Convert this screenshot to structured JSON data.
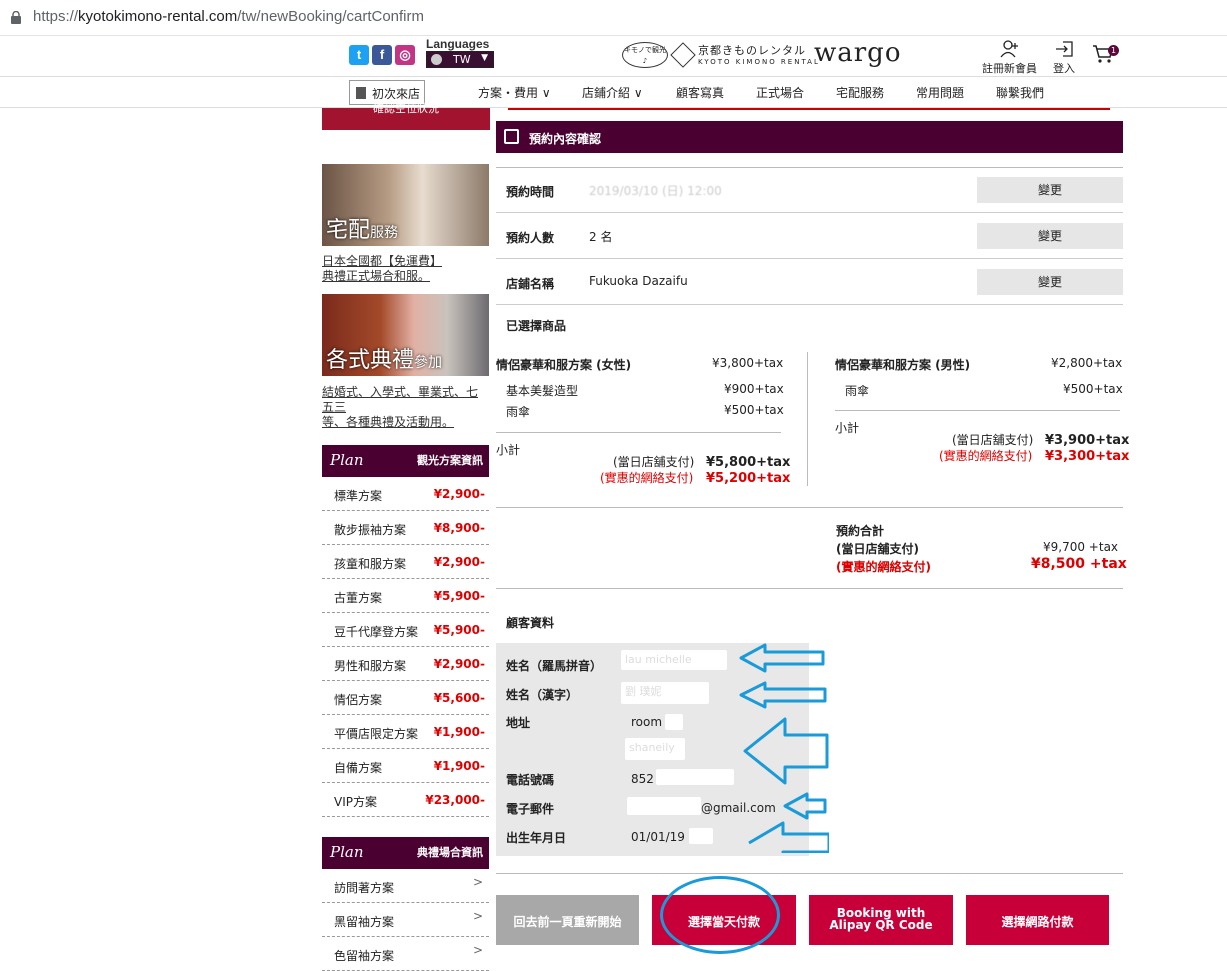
{
  "browser": {
    "url_prefix": "https://",
    "url_host": "kyotokimono-rental.com",
    "url_path": "/tw/newBooking/cartConfirm"
  },
  "header": {
    "languages_label": "Languages",
    "language_value": "TW",
    "logo_badge": "キモノで観光♪",
    "logo_jp": "京都きものレンタル",
    "logo_en": "KYOTO KIMONO RENTAL",
    "logo_wargo": "wargo",
    "register_label": "註冊新會員",
    "login_label": "登入",
    "cart_count": "1"
  },
  "nav": {
    "first_visit": "初次來店",
    "items": [
      "方案・費用 ∨",
      "店鋪介紹 ∨",
      "顧客寫真",
      "正式場合",
      "宅配服務",
      "常用問題",
      "聯繫我們"
    ]
  },
  "sidebar": {
    "confirm_button": "確認空位狀況",
    "banner1_title": "宅配",
    "banner1_small": "服務",
    "banner1_link1": "日本全國都【免運費】",
    "banner1_link2": "典禮正式場合和服。",
    "banner2_title": "各式典禮",
    "banner2_small": "參加",
    "banner2_link1": "結婚式、入學式、畢業式、七",
    "banner2_link2": "五三",
    "banner2_link3": "等、各種典禮及活動用。",
    "plan1_head": "Plan",
    "plan1_sub": "觀光方案資訊",
    "plans": [
      {
        "name": "標準方案",
        "price": "¥2,900-"
      },
      {
        "name": "散步振袖方案",
        "price": "¥8,900-"
      },
      {
        "name": "孩童和服方案",
        "price": "¥2,900-"
      },
      {
        "name": "古董方案",
        "price": "¥5,900-"
      },
      {
        "name": "豆千代摩登方案",
        "price": "¥5,900-"
      },
      {
        "name": "男性和服方案",
        "price": "¥2,900-"
      },
      {
        "name": "情侶方案",
        "price": "¥5,600-"
      },
      {
        "name": "平價店限定方案",
        "price": "¥1,900-"
      },
      {
        "name": "自備方案",
        "price": "¥1,900-"
      },
      {
        "name": "VIP方案",
        "price": "¥23,000-"
      }
    ],
    "plan2_head": "Plan",
    "plan2_sub": "典禮場合資訊",
    "plans2": [
      {
        "name": "訪問著方案",
        "chev": ">"
      },
      {
        "name": "黑留袖方案",
        "chev": ">"
      },
      {
        "name": "色留袖方案",
        "chev": ">"
      }
    ]
  },
  "main": {
    "section_title": "預約內容確認",
    "rows": [
      {
        "key": "預約時間",
        "value": "2019/03/10 (日) 12:00",
        "button": "變更"
      },
      {
        "key": "預約人數",
        "value": "2 名",
        "button": "變更"
      },
      {
        "key": "店鋪名稱",
        "value": "Fukuoka Dazaifu",
        "button": "變更"
      }
    ],
    "selected_label": "已選擇商品",
    "left_plan": {
      "name": "情侶豪華和服方案 (女性)",
      "price": "¥3,800+tax",
      "options": [
        {
          "name": "基本美髮造型",
          "price": "¥900+tax"
        },
        {
          "name": "雨傘",
          "price": "¥500+tax"
        }
      ],
      "subtotal_label": "小計",
      "store_pay_label": "(當日店舖支付)",
      "store_pay": "¥5,800+tax",
      "online_pay_label": "(實惠的網絡支付)",
      "online_pay": "¥5,200+tax"
    },
    "right_plan": {
      "name": "情侶豪華和服方案 (男性)",
      "price": "¥2,800+tax",
      "options": [
        {
          "name": "雨傘",
          "price": "¥500+tax"
        }
      ],
      "subtotal_label": "小計",
      "store_pay_label": "(當日店舖支付)",
      "store_pay": "¥3,900+tax",
      "online_pay_label": "(實惠的網絡支付)",
      "online_pay": "¥3,300+tax"
    },
    "total": {
      "label": "預約合計",
      "store_pay_label": "(當日店舖支付)",
      "store_pay": "¥9,700 +tax",
      "online_pay_label": "(實惠的網絡支付)",
      "online_pay": "¥8,500 +tax"
    },
    "customer": {
      "title": "顧客資料",
      "fields": [
        {
          "key": "姓名（羅馬拼音）",
          "value": "lau michelle"
        },
        {
          "key": "姓名（漢字）",
          "value": "劉 璞妮"
        },
        {
          "key": "地址",
          "value": "room",
          "value2": "shaneily"
        },
        {
          "key": "電話號碼",
          "value": "852"
        },
        {
          "key": "電子郵件",
          "value": "@gmail.com"
        },
        {
          "key": "出生年月日",
          "value": "01/01/19"
        }
      ]
    },
    "buttons": {
      "back": "回去前一頁重新開始",
      "pay_store": "選擇當天付款",
      "alipay_line1": "Booking with",
      "alipay_line2": "Alipay QR Code",
      "pay_online": "選擇網路付款"
    }
  },
  "colors": {
    "brand": "#4a0030",
    "accent_red": "#c8003a",
    "button_gray": "#a8a8a8",
    "annotation_blue": "#1a9ad8"
  }
}
